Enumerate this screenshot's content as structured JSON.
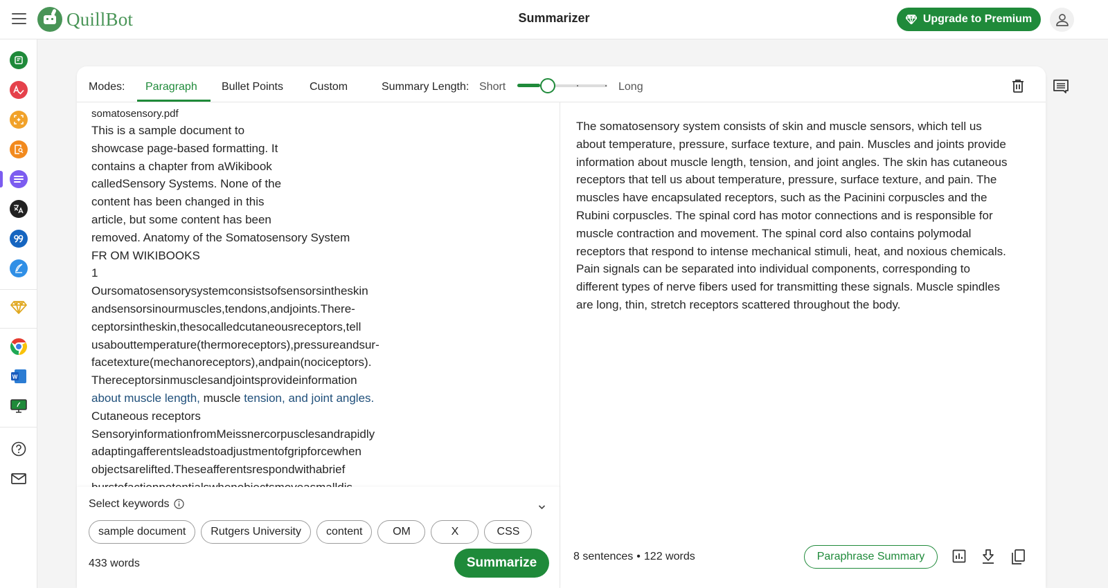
{
  "app": {
    "brand": "QuillBot",
    "page_title": "Summarizer",
    "upgrade_label": "Upgrade to Premium",
    "colors": {
      "accent": "#1f8a3a",
      "brand": "#499557",
      "active_sidebar": "#7c5cf0",
      "highlight_text": "#1f4f7a"
    }
  },
  "sidebar": {
    "items": [
      {
        "name": "paraphraser",
        "icon": "paraphraser-icon",
        "color": "#1f8a3a",
        "active": false
      },
      {
        "name": "grammar-checker",
        "icon": "grammar-check-icon",
        "color": "#e5414b",
        "active": false
      },
      {
        "name": "ai-detector",
        "icon": "ai-detector-icon",
        "color": "#f1a22a",
        "active": false
      },
      {
        "name": "plagiarism-checker",
        "icon": "plagiarism-icon",
        "color": "#f28a1e",
        "active": false
      },
      {
        "name": "summarizer",
        "icon": "summarizer-icon",
        "color": "#7c5cf0",
        "active": true
      },
      {
        "name": "translator",
        "icon": "translate-icon",
        "color": "#222222",
        "active": false
      },
      {
        "name": "citation-generator",
        "icon": "quote-icon",
        "color": "#1565c0",
        "active": false
      },
      {
        "name": "quillbot-flow",
        "icon": "quill-pen-icon",
        "color": "#2f8fe6",
        "active": false
      },
      {
        "name": "premium",
        "icon": "diamond-icon",
        "color": "#e0a820",
        "active": false
      },
      {
        "name": "chrome-extension",
        "icon": "chrome-icon",
        "active": false
      },
      {
        "name": "word-addin",
        "icon": "word-icon",
        "active": false
      },
      {
        "name": "desktop-app",
        "icon": "desktop-icon",
        "active": false
      },
      {
        "name": "help",
        "icon": "help-icon",
        "active": false
      },
      {
        "name": "contact",
        "icon": "mail-icon",
        "active": false
      }
    ]
  },
  "toolbar": {
    "modes_label": "Modes:",
    "tabs": [
      {
        "label": "Paragraph",
        "active": true
      },
      {
        "label": "Bullet Points",
        "active": false
      },
      {
        "label": "Custom",
        "active": false
      }
    ],
    "length_label": "Summary Length:",
    "short_label": "Short",
    "long_label": "Long",
    "length_value_fraction": 0.25
  },
  "input": {
    "filename": "somatosensory.pdf",
    "lines": [
      "This is a sample document to",
      "showcase page-based formatting. It",
      "contains a chapter from aWikibook",
      "calledSensory Systems. None of the",
      "content has been changed in this",
      "article, but some content has been",
      "removed. Anatomy of the Somatosensory System",
      "FR OM WIKIBOOKS",
      "1",
      "Oursomatosensorysystemconsistsofsensorsintheskin",
      "andsensorsinourmuscles,tendons,andjoints.There-",
      "ceptorsintheskin,thesocalledcutaneousreceptors,tell",
      "usabouttemperature(thermoreceptors),pressureandsur-",
      "facetexture(mechanoreceptors),andpain(nociceptors).",
      "Thereceptorsinmusclesandjointsprovideinformation"
    ],
    "highlight_line": {
      "part1": "about muscle length,",
      "part2": " muscle ",
      "part3": "tension, and joint angles."
    },
    "lines_after": [
      "Cutaneous receptors",
      "SensoryinformationfromMeissnercorpusclesandrapidly",
      "adaptingafferentsleadstoadjustmentofgripforcewhen",
      "objectsarelifted.Theseafferentsrespondwithabrief",
      "burstofactionpotentialswhenobjectsmoveasmalldis-"
    ],
    "keywords_label": "Select keywords",
    "keywords": [
      "sample document",
      "Rutgers University",
      "content",
      "OM",
      "X",
      "CSS"
    ],
    "word_count": "433 words",
    "summarize_label": "Summarize"
  },
  "output": {
    "summary": "The somatosensory system consists of skin and muscle sensors, which tell us about temperature, pressure, surface texture, and pain. Muscles and joints provide information about muscle length, tension, and joint angles. The skin has cutaneous receptors that tell us about temperature, pressure, surface texture, and pain. The muscles have encapsulated receptors, such as the Pacinini corpuscles and the Rubini corpuscles. The spinal cord has motor connections and is responsible for muscle contraction and movement. The spinal cord also contains polymodal receptors that respond to intense mechanical stimuli, heat, and noxious chemicals. Pain signals can be separated into individual components, corresponding to different types of nerve fibers used for transmitting these signals. Muscle spindles are long, thin, stretch receptors scattered throughout the body.",
    "sentences": "8 sentences",
    "separator": "•",
    "words": "122 words",
    "paraphrase_label": "Paraphrase Summary"
  }
}
